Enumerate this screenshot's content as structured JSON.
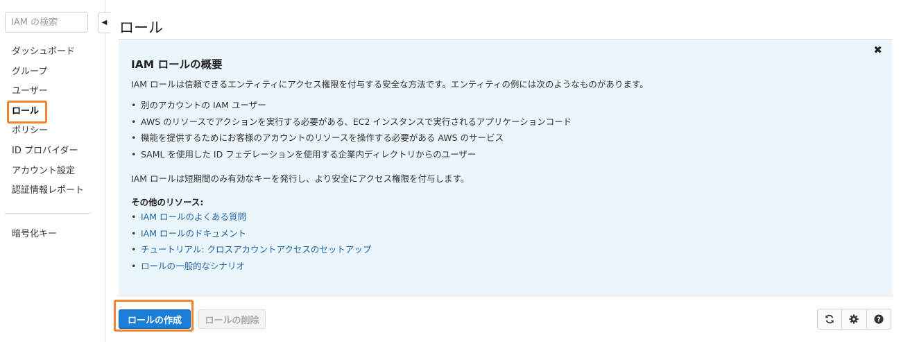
{
  "sidebar": {
    "search_placeholder": "IAM の検索",
    "items": [
      {
        "label": "ダッシュボード"
      },
      {
        "label": "グループ"
      },
      {
        "label": "ユーザー"
      },
      {
        "label": "ロール"
      },
      {
        "label": "ポリシー"
      },
      {
        "label": "ID プロバイダー"
      },
      {
        "label": "アカウント設定"
      },
      {
        "label": "認証情報レポート"
      }
    ],
    "secondary": "暗号化キー",
    "active": "ロール"
  },
  "page": {
    "title": "ロール"
  },
  "info": {
    "heading": "IAM ロールの概要",
    "intro": "IAM ロールは信頼できるエンティティにアクセス権限を付与する安全な方法です。エンティティの例には次のようなものがあります。",
    "bullets": [
      "別のアカウントの IAM ユーザー",
      "AWS のリソースでアクションを実行する必要がある、EC2 インスタンスで実行されるアプリケーションコード",
      "機能を提供するためにお客様のアカウントのリソースを操作する必要がある AWS のサービス",
      "SAML を使用した ID フェデレーションを使用する企業内ディレクトリからのユーザー"
    ],
    "note": "IAM ロールは短期間のみ有効なキーを発行し、より安全にアクセス権限を付与します。",
    "resources_heading": "その他のリソース:",
    "links": [
      "IAM ロールのよくある質問",
      "IAM ロールのドキュメント",
      "チュートリアル: クロスアカウントアクセスのセットアップ",
      "ロールの一般的なシナリオ"
    ]
  },
  "toolbar": {
    "create_label": "ロールの作成",
    "delete_label": "ロールの削除"
  },
  "icons": [
    "refresh-icon",
    "gear-icon",
    "help-icon",
    "close-icon",
    "collapse-icon"
  ],
  "colors": {
    "primary": "#1a7fd6",
    "highlight": "#f0852f",
    "panel": "#ebf5fc",
    "link": "#1f64a8"
  }
}
